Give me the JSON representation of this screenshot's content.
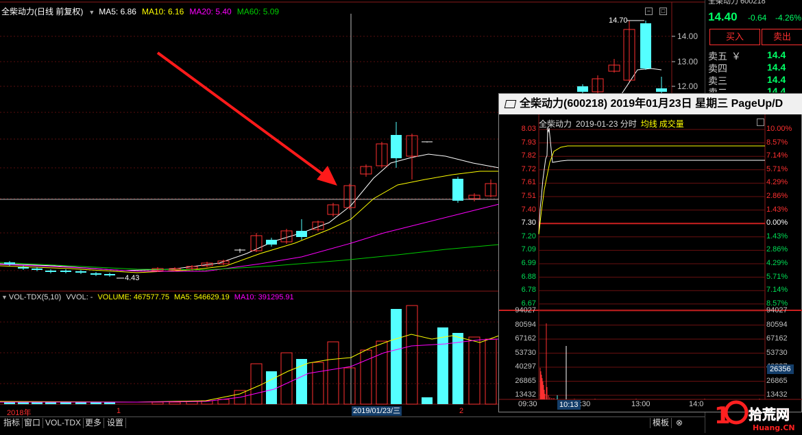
{
  "header": {
    "stock_name": "全柴动力(日线 前复权)",
    "ma5": "MA5: 6.86",
    "ma10": "MA10: 6.16",
    "ma20": "MA20: 5.40",
    "ma60": "MA60: 5.09",
    "colors": {
      "ma5": "#ffffff",
      "ma10": "#ffff00",
      "ma20": "#ff00ff",
      "ma60": "#00cc00"
    }
  },
  "price_axis": {
    "labels": [
      "14.00",
      "13.00",
      "12.00"
    ],
    "high_label": "14.70",
    "low_label": "4.43"
  },
  "volume_header": {
    "indicator": "VOL-TDX(5,10)",
    "vvol": "VVOL: -",
    "volume": "VOLUME: 467577.75",
    "ma5": "MA5: 546629.19",
    "ma10": "MA10: 391295.91"
  },
  "date_axis": {
    "year_label": "2018年",
    "month1": "1",
    "month2": "2",
    "cursor_date": "2019/01/23/三"
  },
  "bottom_bar": {
    "tabs": [
      "指标",
      "窗口",
      "VOL-TDX",
      "更多",
      "设置"
    ],
    "right_tab": "模板",
    "close_glyph": "⊗"
  },
  "quote_panel": {
    "title": "全柴动力  600218",
    "price": "14.40",
    "change": "-0.64",
    "change_pct": "-4.26%",
    "buy_label": "买入",
    "sell_label": "卖出",
    "order_book": [
      {
        "level": "卖五",
        "price": "14.4"
      },
      {
        "level": "卖四",
        "price": "14.4"
      },
      {
        "level": "卖三",
        "price": "14.4"
      },
      {
        "level": "卖二",
        "price": "14.4"
      }
    ]
  },
  "popup": {
    "title": "全柴动力(600218) 2019年01月23日 星期三 PageUp/D",
    "subtitle_name": "全柴动力",
    "subtitle_date": "2019-01-23 分时",
    "avg_label": "均线",
    "vol_label": "成交量",
    "price_ticks": [
      "8.03",
      "7.93",
      "7.82",
      "7.72",
      "7.61",
      "7.51",
      "7.40",
      "7.30",
      "7.20",
      "7.09",
      "6.99",
      "6.88",
      "6.78",
      "6.67"
    ],
    "pct_ticks": [
      "10.00%",
      "8.57%",
      "7.14%",
      "5.71%",
      "4.29%",
      "2.86%",
      "1.43%",
      "0.00%",
      "1.43%",
      "2.86%",
      "4.29%",
      "5.71%",
      "7.14%",
      "8.57%"
    ],
    "vol_ticks": [
      "94027",
      "80594",
      "67162",
      "53730",
      "40297",
      "26865",
      "13432"
    ],
    "vol_badge": "26356",
    "time_ticks": [
      "09:30",
      "10:13",
      ":30",
      "13:00",
      "14:0"
    ],
    "colors": {
      "up": "#ff3030",
      "neutral": "#ffffff",
      "down": "#54ffff",
      "avg": "#ffff00"
    }
  },
  "watermark": {
    "text": "10拾荒网",
    "sub": "Huang.CN"
  }
}
